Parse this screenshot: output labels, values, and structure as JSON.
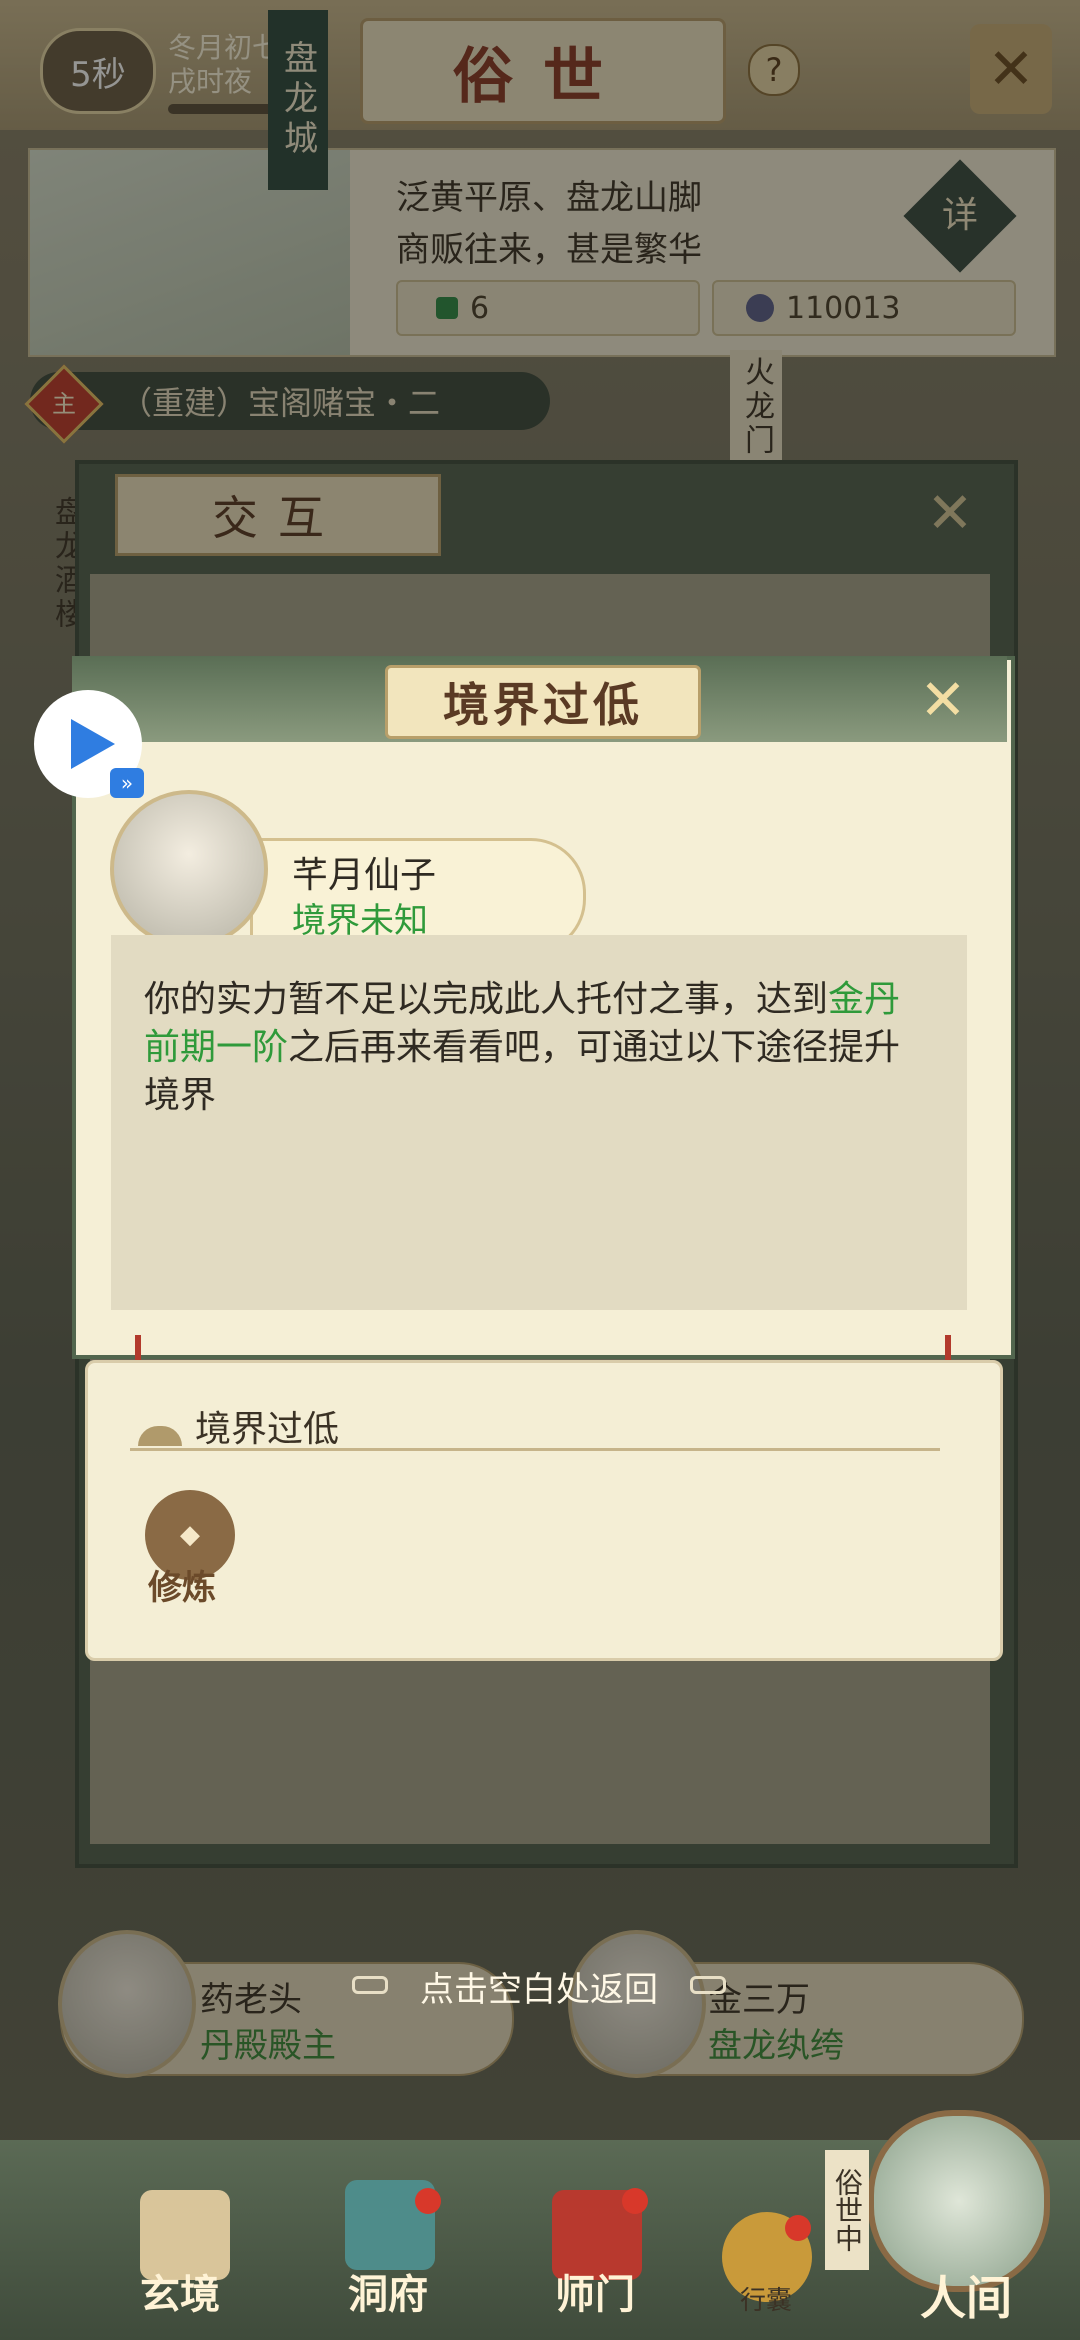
{
  "topbar": {
    "timer": "5秒",
    "date_line1": "冬月初七",
    "date_line2": "戌时夜",
    "title": "俗世"
  },
  "city": {
    "name": "盘龙城",
    "desc_line1": "泛黄平原、盘龙山脚",
    "desc_line2": "商贩往来，甚是繁华",
    "res1": "6",
    "res2": "110013",
    "detail_label": "详"
  },
  "quest": {
    "badge": "主",
    "label": "（重建）宝阁赌宝・二"
  },
  "side_labels": {
    "left": "盘龙酒楼",
    "gate": "火龙门"
  },
  "interact_panel": {
    "title": "交互"
  },
  "modal": {
    "title": "境界过低",
    "npc_name": "芊月仙子",
    "npc_realm": "境界未知",
    "message_part1": "你的实力暂不足以完成此人托付之事，达到",
    "message_highlight": "金丹前期一阶",
    "message_part2": "之后再来看看吧，可通过以下途径提升境界"
  },
  "hint": {
    "title": "境界过低",
    "action_label": "修炼"
  },
  "npcs": [
    {
      "name": "药老头",
      "title": "丹殿殿主"
    },
    {
      "name": "金三万",
      "title": "盘龙纨绔"
    }
  ],
  "back_hint": "点击空白处返回",
  "nav": {
    "items": [
      "玄境",
      "洞府",
      "师门",
      "行囊",
      "人间"
    ],
    "current_tag": "俗世中"
  },
  "colors": {
    "accent_green": "#2f9a3a",
    "title_red": "#8a3a26",
    "modal_green": "#52664e"
  }
}
